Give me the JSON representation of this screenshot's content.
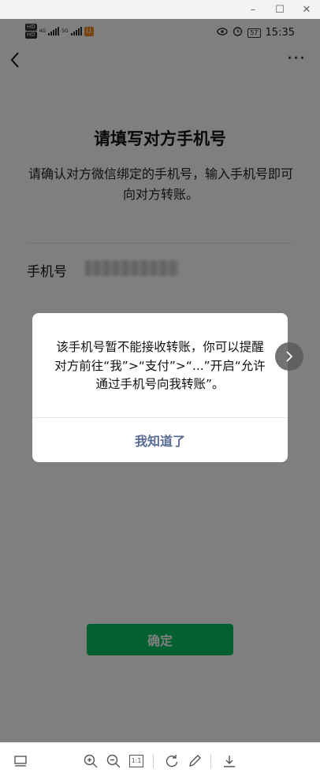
{
  "viewer": {
    "minimize": "–",
    "maximize": "☐",
    "close": "✕"
  },
  "status_bar": {
    "hd1": "HD",
    "hd2": "HD",
    "net1": "4G",
    "net2": "5G",
    "app_badge": "U",
    "battery": "57",
    "time": "15:35"
  },
  "nav": {
    "back_icon": "chevron-left-icon",
    "more": "···"
  },
  "page": {
    "title": "请填写对方手机号",
    "description": "请确认对方微信绑定的手机号，输入手机号即可向对方转账。",
    "phone_label": "手机号",
    "confirm_button": "确定"
  },
  "dialog": {
    "message": "该手机号暂不能接收转账，你可以提醒对方前往“我”>“支付”>“...”开启“允许通过手机号向我转账”。",
    "button": "我知道了"
  },
  "colors": {
    "accent_green": "#07c160",
    "dialog_link": "#576b95"
  },
  "toolbar": {
    "actual_size": "1:1"
  }
}
